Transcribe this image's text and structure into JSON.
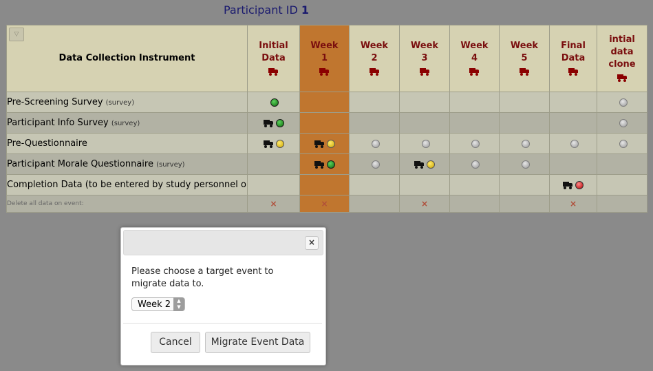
{
  "participant": {
    "label": "Participant ID",
    "id": "1"
  },
  "table": {
    "instrument_header": "Data Collection Instrument",
    "events": [
      {
        "line1": "Initial",
        "line2": "Data",
        "line3": ""
      },
      {
        "line1": "Week",
        "line2": "1",
        "line3": ""
      },
      {
        "line1": "Week",
        "line2": "2",
        "line3": ""
      },
      {
        "line1": "Week",
        "line2": "3",
        "line3": ""
      },
      {
        "line1": "Week",
        "line2": "4",
        "line3": ""
      },
      {
        "line1": "Week",
        "line2": "5",
        "line3": ""
      },
      {
        "line1": "Final",
        "line2": "Data",
        "line3": ""
      },
      {
        "line1": "intial",
        "line2": "data",
        "line3": "clone"
      }
    ],
    "rows": [
      {
        "name": "Pre-Screening Survey",
        "tag": "(survey)",
        "cells": [
          {
            "s": "green"
          },
          {},
          {},
          {},
          {},
          {},
          {},
          {
            "s": "gray"
          }
        ]
      },
      {
        "name": "Participant Info Survey",
        "tag": "(survey)",
        "cells": [
          {
            "s": "green",
            "truck": true
          },
          {},
          {},
          {},
          {},
          {},
          {},
          {
            "s": "gray"
          }
        ]
      },
      {
        "name": "Pre-Questionnaire",
        "tag": "",
        "cells": [
          {
            "s": "yellow",
            "truck": true
          },
          {
            "s": "yellow",
            "truck": true
          },
          {
            "s": "gray"
          },
          {
            "s": "gray"
          },
          {
            "s": "gray"
          },
          {
            "s": "gray"
          },
          {
            "s": "gray"
          },
          {
            "s": "gray"
          }
        ]
      },
      {
        "name": "Participant Morale Questionnaire",
        "tag": "(survey)",
        "cells": [
          {},
          {
            "s": "green",
            "truck": true
          },
          {
            "s": "gray"
          },
          {
            "s": "yellow",
            "truck": true
          },
          {
            "s": "gray"
          },
          {
            "s": "gray"
          },
          {},
          {}
        ]
      },
      {
        "name": "Completion Data (to be entered by study personnel only)",
        "tag": "",
        "cells": [
          {},
          {},
          {},
          {},
          {},
          {},
          {
            "s": "red",
            "truck": true
          },
          {}
        ]
      }
    ],
    "delete_row": {
      "label": "Delete all data on event:",
      "marks": [
        "×",
        "×",
        "",
        "×",
        "",
        "",
        "×",
        ""
      ]
    }
  },
  "dialog": {
    "message": "Please choose a target event to migrate data to.",
    "select_value": "Week 2",
    "close_glyph": "×",
    "cancel_label": "Cancel",
    "migrate_label": "Migrate Event Data"
  },
  "colors": {
    "highlight_column": "#c0762f",
    "header_text": "#7a0e0e",
    "status_green": "#0d6b0d",
    "status_yellow": "#c9a400",
    "status_red": "#b20000",
    "status_gray": "#9a9a9a"
  },
  "icons": {
    "truck": "truck-icon",
    "status": "status-circle-icon",
    "delete": "delete-x-icon",
    "close": "close-icon",
    "collapse": "collapse-triangle-icon"
  }
}
